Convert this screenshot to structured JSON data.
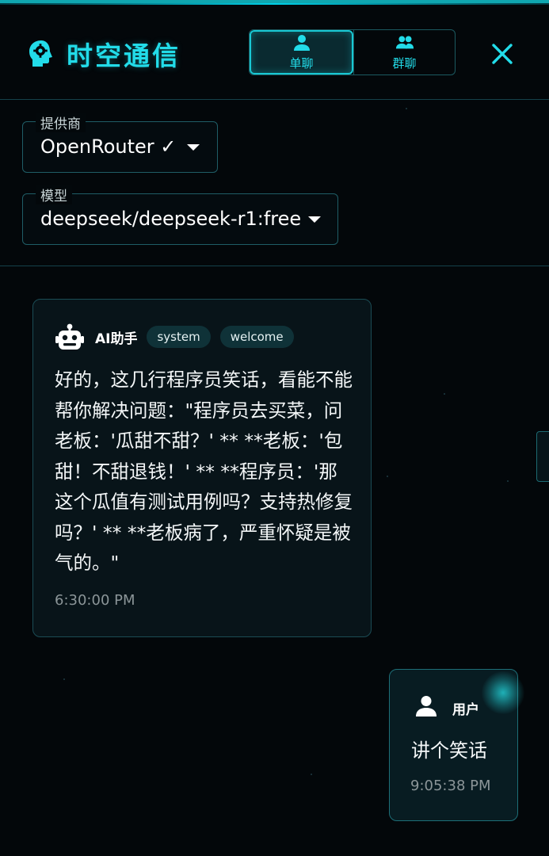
{
  "header": {
    "title": "时空通信",
    "brand_icon": "brain-gear-icon",
    "modes": [
      {
        "label": "单聊",
        "icon": "user-icon",
        "active": true
      },
      {
        "label": "群聊",
        "icon": "users-icon",
        "active": false
      }
    ],
    "close_icon": "close-icon"
  },
  "settings": {
    "provider": {
      "label": "提供商",
      "value": "OpenRouter ✓"
    },
    "model": {
      "label": "模型",
      "value": "deepseek/deepseek-r1:free"
    }
  },
  "messages": [
    {
      "sender": "AI助手",
      "icon": "robot-icon",
      "tags": [
        "system",
        "welcome"
      ],
      "text": "好的，这几行程序员笑话，看能不能帮你解决问题：\"程序员去买菜，问老板：'瓜甜不甜？' ** **老板：'包甜！不甜退钱！' ** **程序员：'那这个瓜值有测试用例吗？支持热修复吗？' ** **老板病了，严重怀疑是被气的。\"",
      "time": "6:30:00 PM"
    },
    {
      "sender": "用户",
      "icon": "user-icon",
      "text": "讲个笑话",
      "time": "9:05:38 PM"
    }
  ],
  "colors": {
    "accent": "#22dce9",
    "background": "#03070a",
    "bubble_ai": "#081419",
    "bubble_user": "#081c22",
    "border": "#1b4c55"
  }
}
